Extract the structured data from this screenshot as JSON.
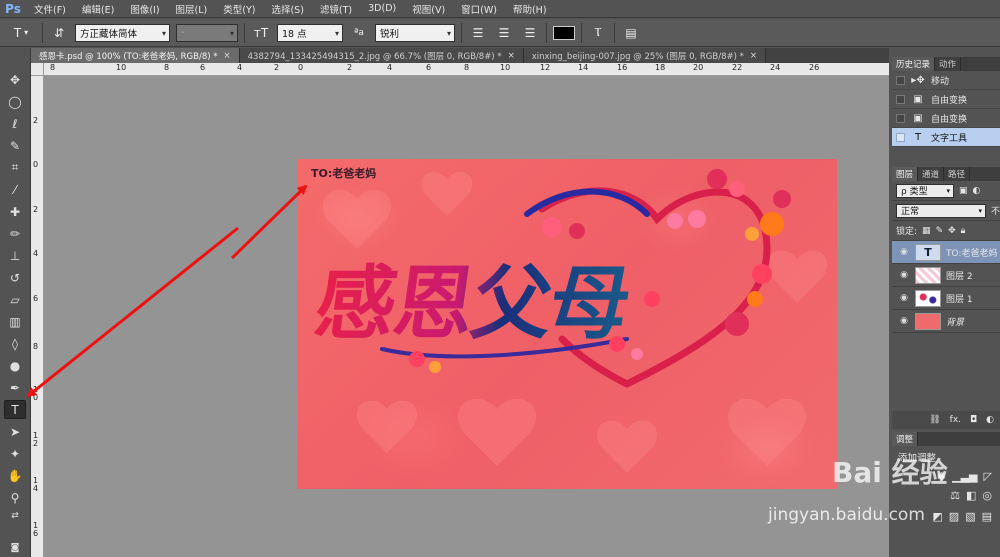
{
  "app": {
    "logo": "Ps"
  },
  "menu": [
    "文件(F)",
    "编辑(E)",
    "图像(I)",
    "图层(L)",
    "类型(Y)",
    "选择(S)",
    "滤镜(T)",
    "3D(D)",
    "视图(V)",
    "窗口(W)",
    "帮助(H)"
  ],
  "options": {
    "font_family": "方正藏体简体",
    "font_style": "-",
    "font_size": "18 点",
    "aa_label": "ªa",
    "anti_alias": "锐利"
  },
  "tabs": [
    {
      "label": "感恩卡.psd @ 100% (TO:老爸老妈, RGB/8) *",
      "active": true
    },
    {
      "label": "4382794_133425494315_2.jpg @ 66.7% (图层 0, RGB/8#) *",
      "active": false
    },
    {
      "label": "xinxing_beijing-007.jpg @ 25% (图层 0, RGB/8#) *",
      "active": false
    }
  ],
  "ruler_top": [
    "8",
    "10",
    "8",
    "6",
    "4",
    "2",
    "0",
    "2",
    "4",
    "6",
    "8",
    "10",
    "12",
    "14",
    "16",
    "18",
    "20",
    "22",
    "24",
    "26"
  ],
  "ruler_left": [
    "2",
    "0",
    "2",
    "4",
    "6",
    "8",
    "1\n0",
    "1\n2",
    "1\n4",
    "1\n6"
  ],
  "canvas": {
    "to_text": "TO:老爸老妈",
    "title": "感恩父母",
    "colors": {
      "background": "#f06868",
      "heart": "#d8204a",
      "text_left": "#d61a55",
      "text_right": "#1a2f7a"
    }
  },
  "history": {
    "tabs": [
      "历史记录",
      "动作"
    ],
    "items": [
      {
        "label": "移动",
        "icon": "move-icon"
      },
      {
        "label": "自由变换",
        "icon": "transform-icon"
      },
      {
        "label": "自由变换",
        "icon": "transform-icon"
      },
      {
        "label": "文字工具",
        "icon": "type-icon"
      }
    ]
  },
  "layers": {
    "tabs": [
      "图层",
      "通道",
      "路径"
    ],
    "filter_label": "ρ 类型",
    "blend_mode": "正常",
    "opacity_label": "不",
    "lock_label": "锁定:",
    "items": [
      {
        "name": "TO:老爸老妈",
        "type": "text"
      },
      {
        "name": "图层 2",
        "type": "pattern"
      },
      {
        "name": "图层 1",
        "type": "flowers"
      },
      {
        "name": "背景",
        "type": "background"
      }
    ]
  },
  "adjustments": {
    "tab": "调整",
    "title": "添加调整"
  },
  "watermark": {
    "brand": "Bai 经验",
    "url": "jingyan.baidu.com"
  }
}
